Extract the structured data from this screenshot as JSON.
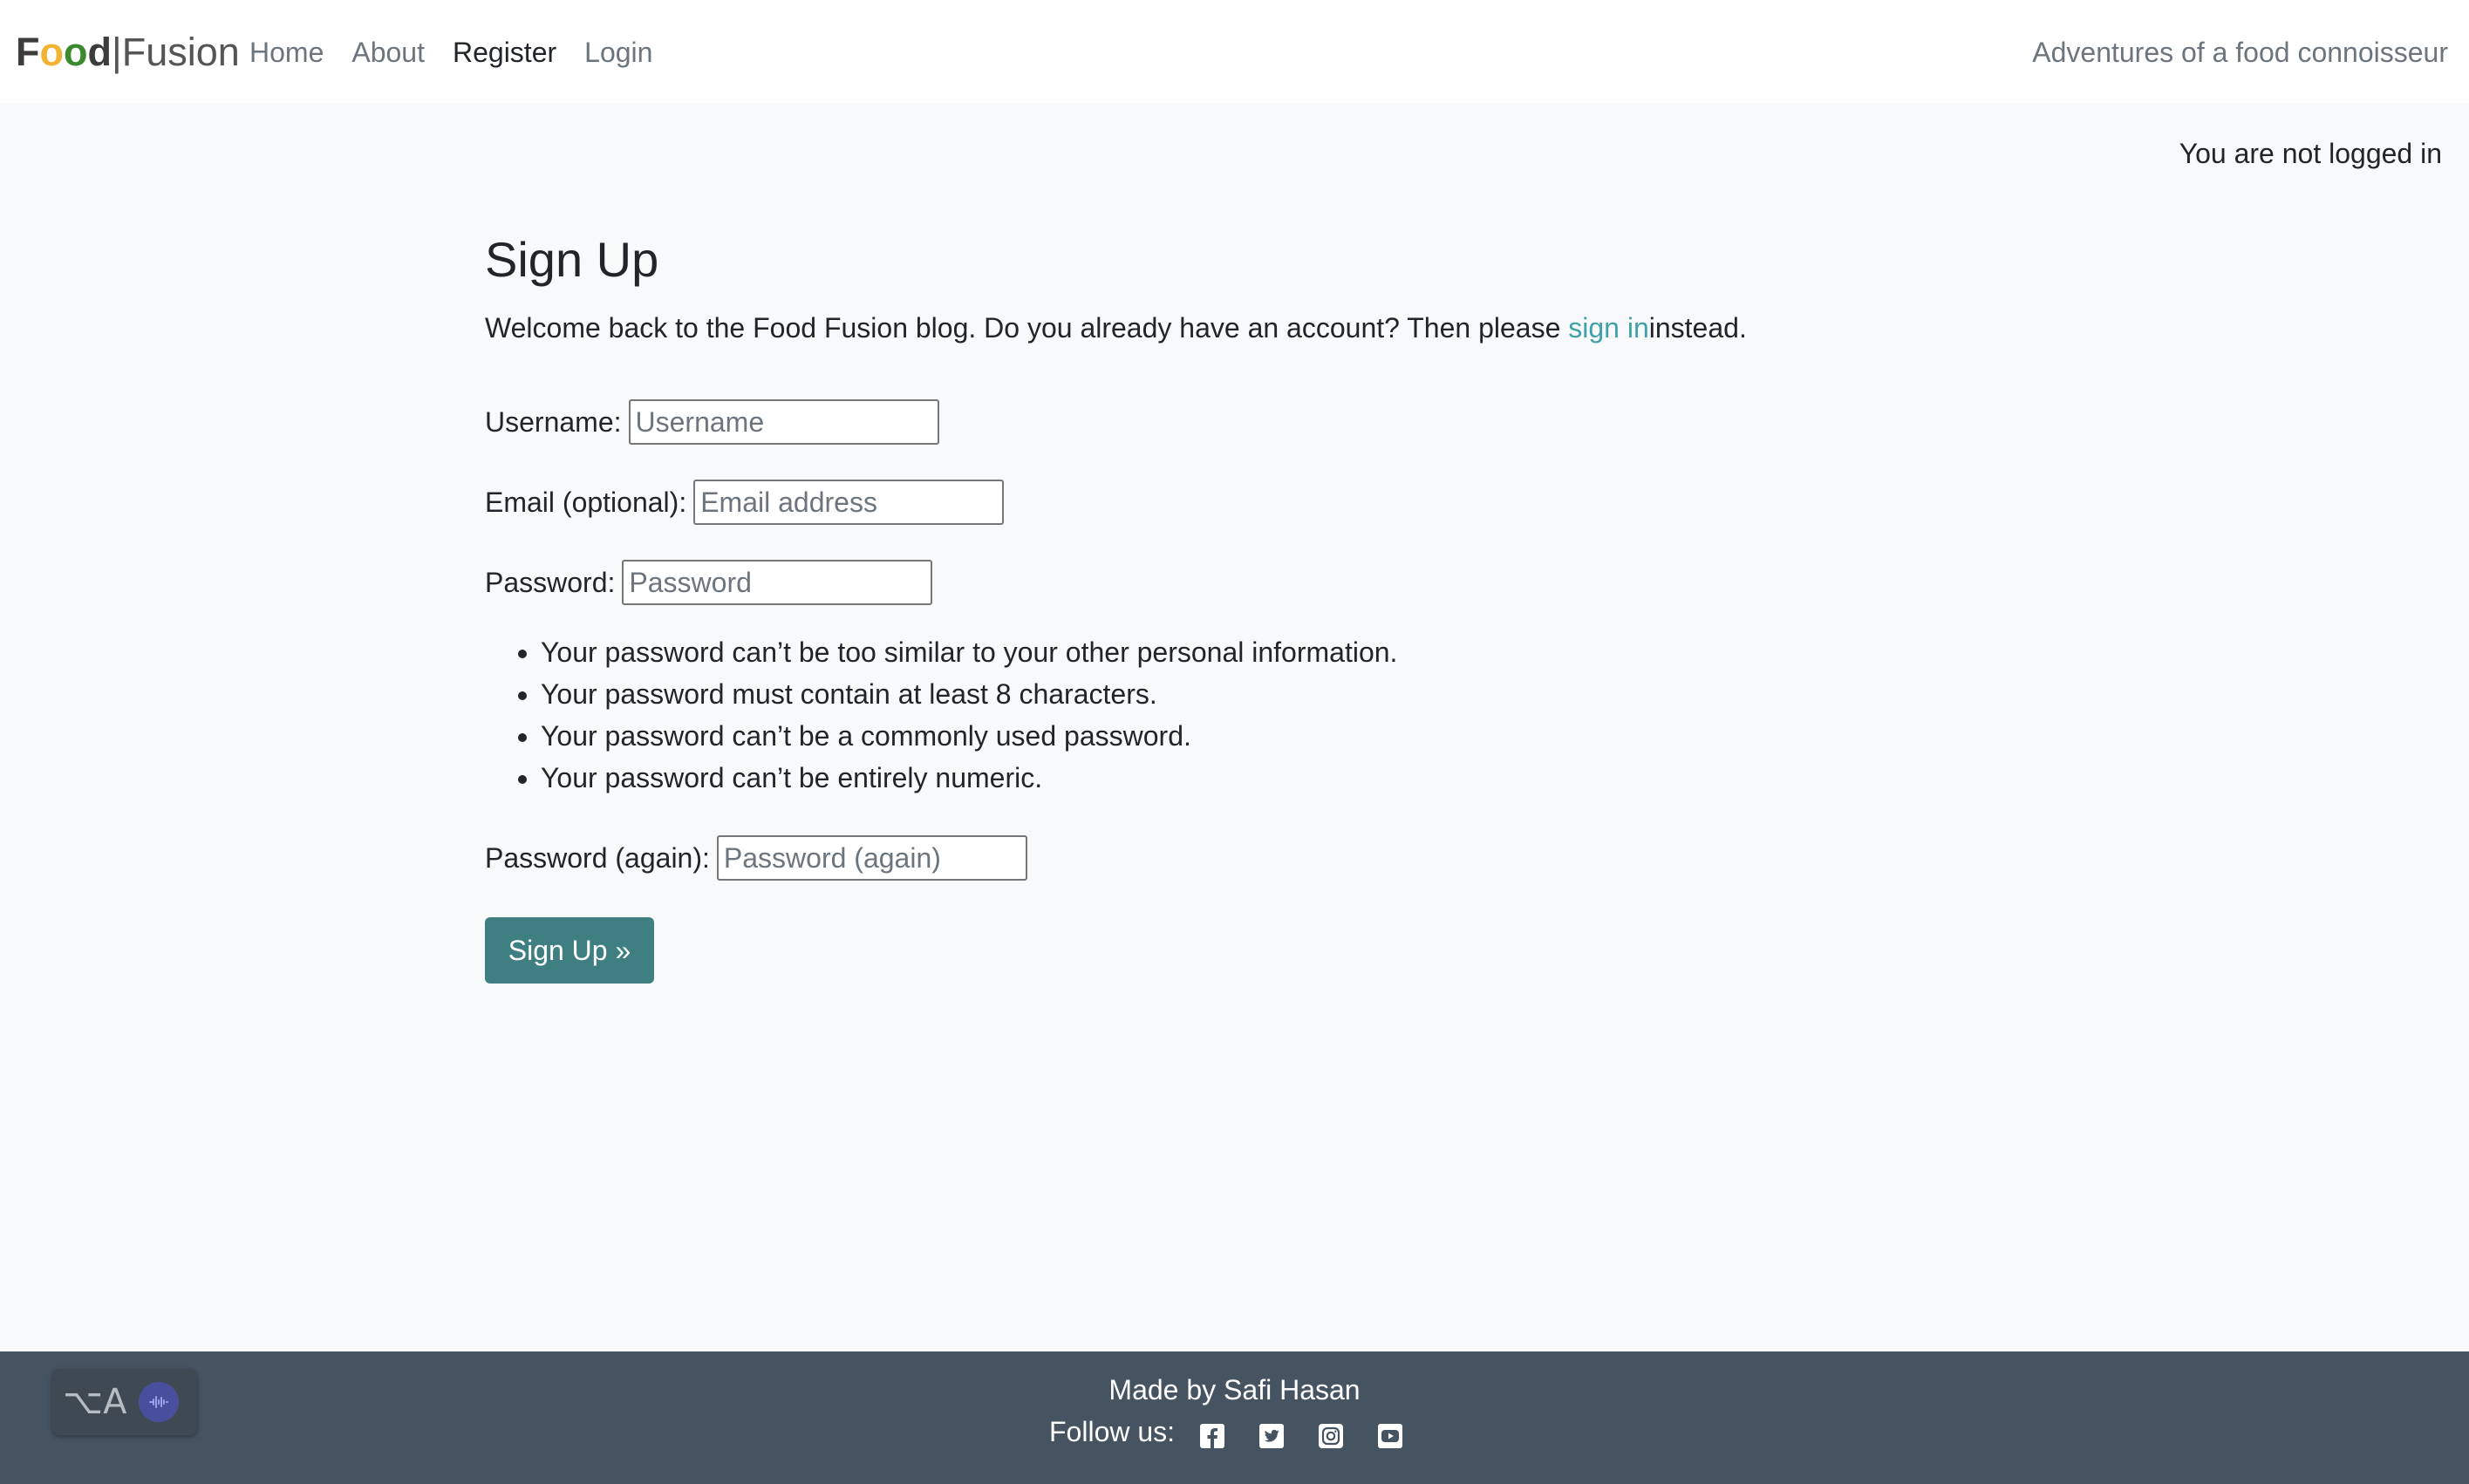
{
  "navbar": {
    "brand_food_letters": [
      "F",
      "o",
      "o",
      "d"
    ],
    "brand_sep": "|",
    "brand_fusion": "Fusion",
    "links": [
      {
        "label": "Home"
      },
      {
        "label": "About"
      },
      {
        "label": "Register"
      },
      {
        "label": "Login"
      }
    ],
    "active_link": "Register",
    "tagline": "Adventures of a food connoisseur"
  },
  "status": {
    "login_text": "You are not logged in"
  },
  "main": {
    "title": "Sign Up",
    "intro_before": "Welcome back to the Food Fusion blog. Do you already have an account? Then please ",
    "intro_link": "sign in",
    "intro_after": "instead.",
    "fields": {
      "username": {
        "label": "Username:",
        "placeholder": "Username"
      },
      "email": {
        "label": "Email (optional):",
        "placeholder": "Email address"
      },
      "password": {
        "label": "Password:",
        "placeholder": "Password"
      },
      "password2": {
        "label": "Password (again):",
        "placeholder": "Password (again)"
      }
    },
    "password_rules": [
      "Your password can’t be too similar to your other personal information.",
      "Your password must contain at least 8 characters.",
      "Your password can’t be a commonly used password.",
      "Your password can’t be entirely numeric."
    ],
    "submit_label": "Sign Up »"
  },
  "footer": {
    "made_by": "Made by Safi Hasan",
    "follow_label": "Follow us:",
    "social_icons": [
      "facebook-icon",
      "twitter-icon",
      "instagram-icon",
      "youtube-icon"
    ]
  },
  "widget": {
    "keys_label": "⌥A",
    "icon": "audio-wave-icon"
  },
  "colors": {
    "accent": "#41a0a8",
    "button": "#3f7f82",
    "footer_bg": "#465462",
    "page_bg": "#f8f9fa"
  }
}
